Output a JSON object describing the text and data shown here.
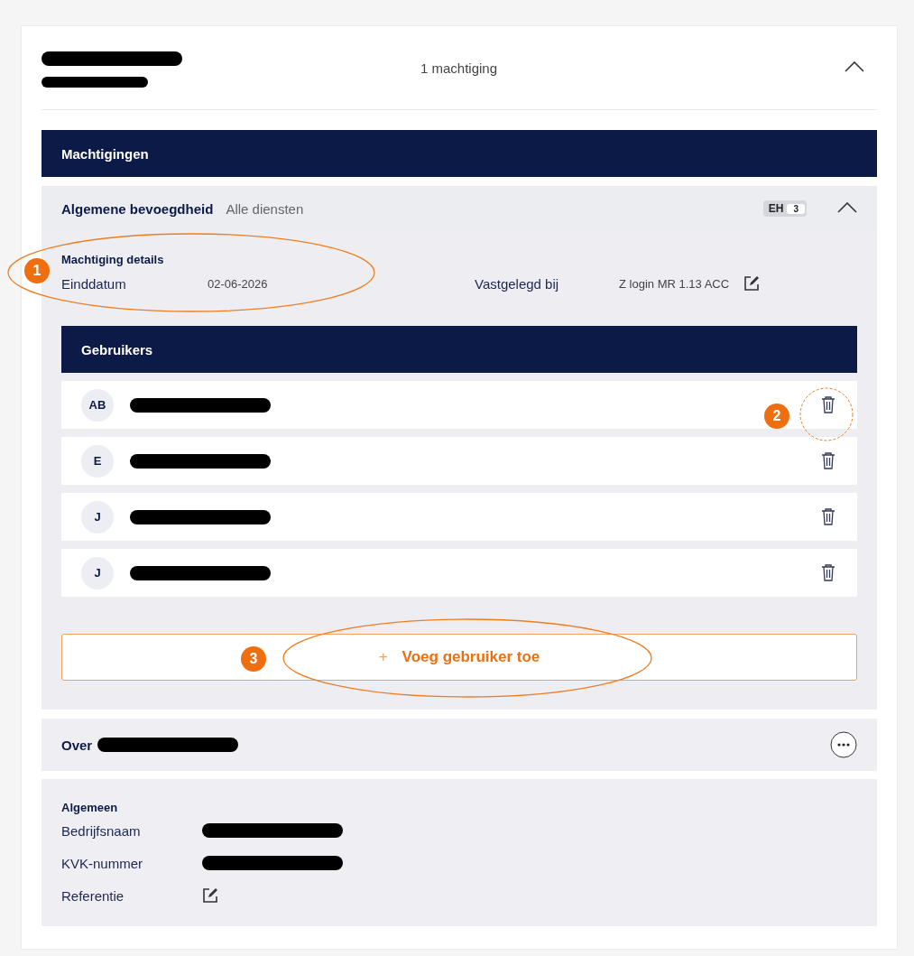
{
  "header": {
    "summary": "1 machtiging",
    "expanded": true
  },
  "section_title": "Machtigingen",
  "authorization": {
    "title": "Algemene bevoegdheid",
    "scope": "Alle diensten",
    "badge": {
      "label": "EH",
      "count": "3"
    },
    "expanded": true,
    "details": {
      "title": "Machtiging details",
      "fields": [
        {
          "label": "Einddatum",
          "value": "02-06-2026"
        },
        {
          "label": "Vastgelegd bij",
          "value": "Z login MR 1.13 ACC",
          "editable": true
        }
      ]
    },
    "users_title": "Gebruikers",
    "users": [
      {
        "initials": "AB"
      },
      {
        "initials": "E"
      },
      {
        "initials": "J"
      },
      {
        "initials": "J"
      }
    ],
    "add_button": {
      "icon": "+",
      "label": "Voeg gebruiker toe"
    }
  },
  "about": {
    "title": "Over",
    "group_title": "Algemeen",
    "fields": [
      {
        "label": "Bedrijfsnaam",
        "redacted": true,
        "editable": false
      },
      {
        "label": "KVK-nummer",
        "redacted": true,
        "editable": false
      },
      {
        "label": "Referentie",
        "redacted": false,
        "editable": true
      }
    ]
  },
  "annotations": [
    {
      "number": "1"
    },
    {
      "number": "2"
    },
    {
      "number": "3"
    }
  ]
}
